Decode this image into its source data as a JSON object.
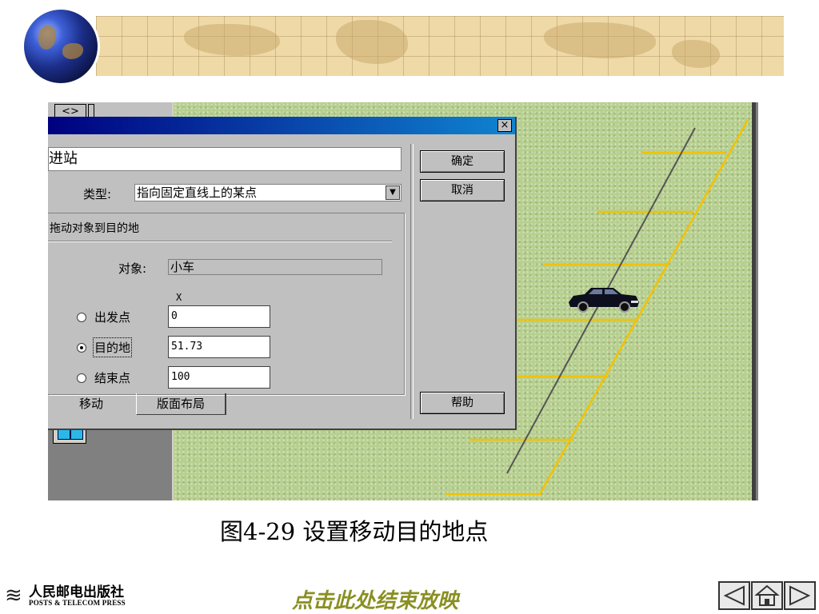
{
  "dialog": {
    "name_value": "进站",
    "type_label": "类型:",
    "type_value": "指向固定直线上的某点",
    "ok_label": "确定",
    "cancel_label": "取消",
    "help_label": "帮助",
    "close_glyph": "×",
    "group_title": "拖动对象到目的地",
    "object_label": "对象:",
    "object_value": "小车",
    "column_header": "X",
    "points": [
      {
        "label": "出发点",
        "value": "0",
        "selected": false
      },
      {
        "label": "目的地",
        "value": "51.73",
        "selected": true
      },
      {
        "label": "结束点",
        "value": "100",
        "selected": false
      }
    ],
    "tabs": [
      "移动",
      "版面布局"
    ]
  },
  "toolbar": {
    "arrows_glyph": "<>"
  },
  "caption": "图4-29  设置移动目的地点",
  "footer": {
    "publisher_cn": "人民邮电出版社",
    "publisher_en": "POSTS & TELECOM PRESS",
    "end_show": "点击此处结束放映"
  },
  "colors": {
    "titlebar": "#000080",
    "grass": "#b7cf8f",
    "parking_line": "#f2c200",
    "caption_footer_link": "#8a8f22"
  },
  "icons": [
    "globe-icon",
    "close-icon",
    "dropdown-arrow-icon",
    "car-icon",
    "prev-icon",
    "home-icon",
    "next-icon"
  ]
}
